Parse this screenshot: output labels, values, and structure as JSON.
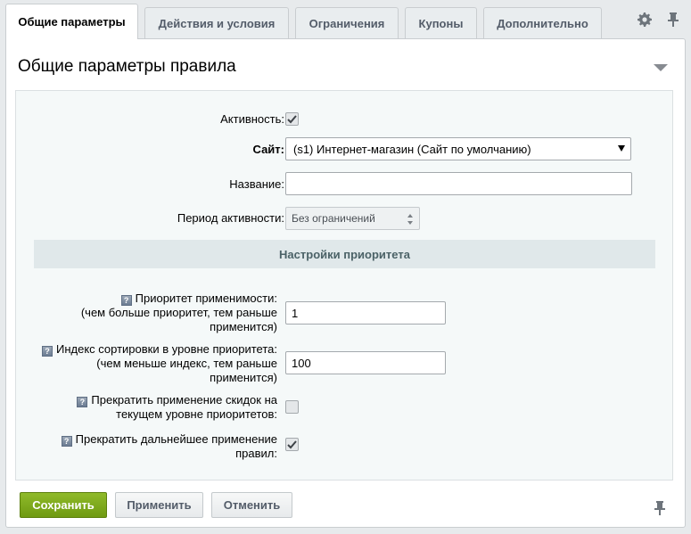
{
  "tabs": [
    {
      "label": "Общие параметры",
      "active": true
    },
    {
      "label": "Действия и условия"
    },
    {
      "label": "Ограничения"
    },
    {
      "label": "Купоны"
    },
    {
      "label": "Дополнительно"
    }
  ],
  "toolbar_icons": [
    "gear-icon",
    "pin-icon"
  ],
  "section": {
    "title": "Общие параметры правила"
  },
  "form": {
    "active_label": "Активность:",
    "active_checked": true,
    "site_label": "Сайт:",
    "site_value": "(s1) Интернет-магазин (Сайт по умолчанию)",
    "name_label": "Название:",
    "name_value": "",
    "period_label": "Период активности:",
    "period_value": "Без ограничений"
  },
  "priority": {
    "header": "Настройки приоритета",
    "apply_priority_label_1": "Приоритет применимости:",
    "apply_priority_label_2": "(чем больше приоритет, тем раньше",
    "apply_priority_label_3": "применится)",
    "apply_priority_value": "1",
    "sort_label_1": "Индекс сортировки в уровне приоритета:",
    "sort_label_2": "(чем меньше индекс, тем раньше",
    "sort_label_3": "применится)",
    "sort_value": "100",
    "stop_level_label_1": "Прекратить применение скидок на",
    "stop_level_label_2": "текущем уровне приоритетов:",
    "stop_level_checked": false,
    "stop_further_label_1": "Прекратить дальнейшее применение",
    "stop_further_label_2": "правил:",
    "stop_further_checked": true
  },
  "buttons": {
    "save": "Сохранить",
    "apply": "Применить",
    "cancel": "Отменить"
  },
  "colors": {
    "save_button": "#7aa51b",
    "priority_header_bg": "#e0e8ea",
    "form_bg": "#f5f9f9"
  }
}
